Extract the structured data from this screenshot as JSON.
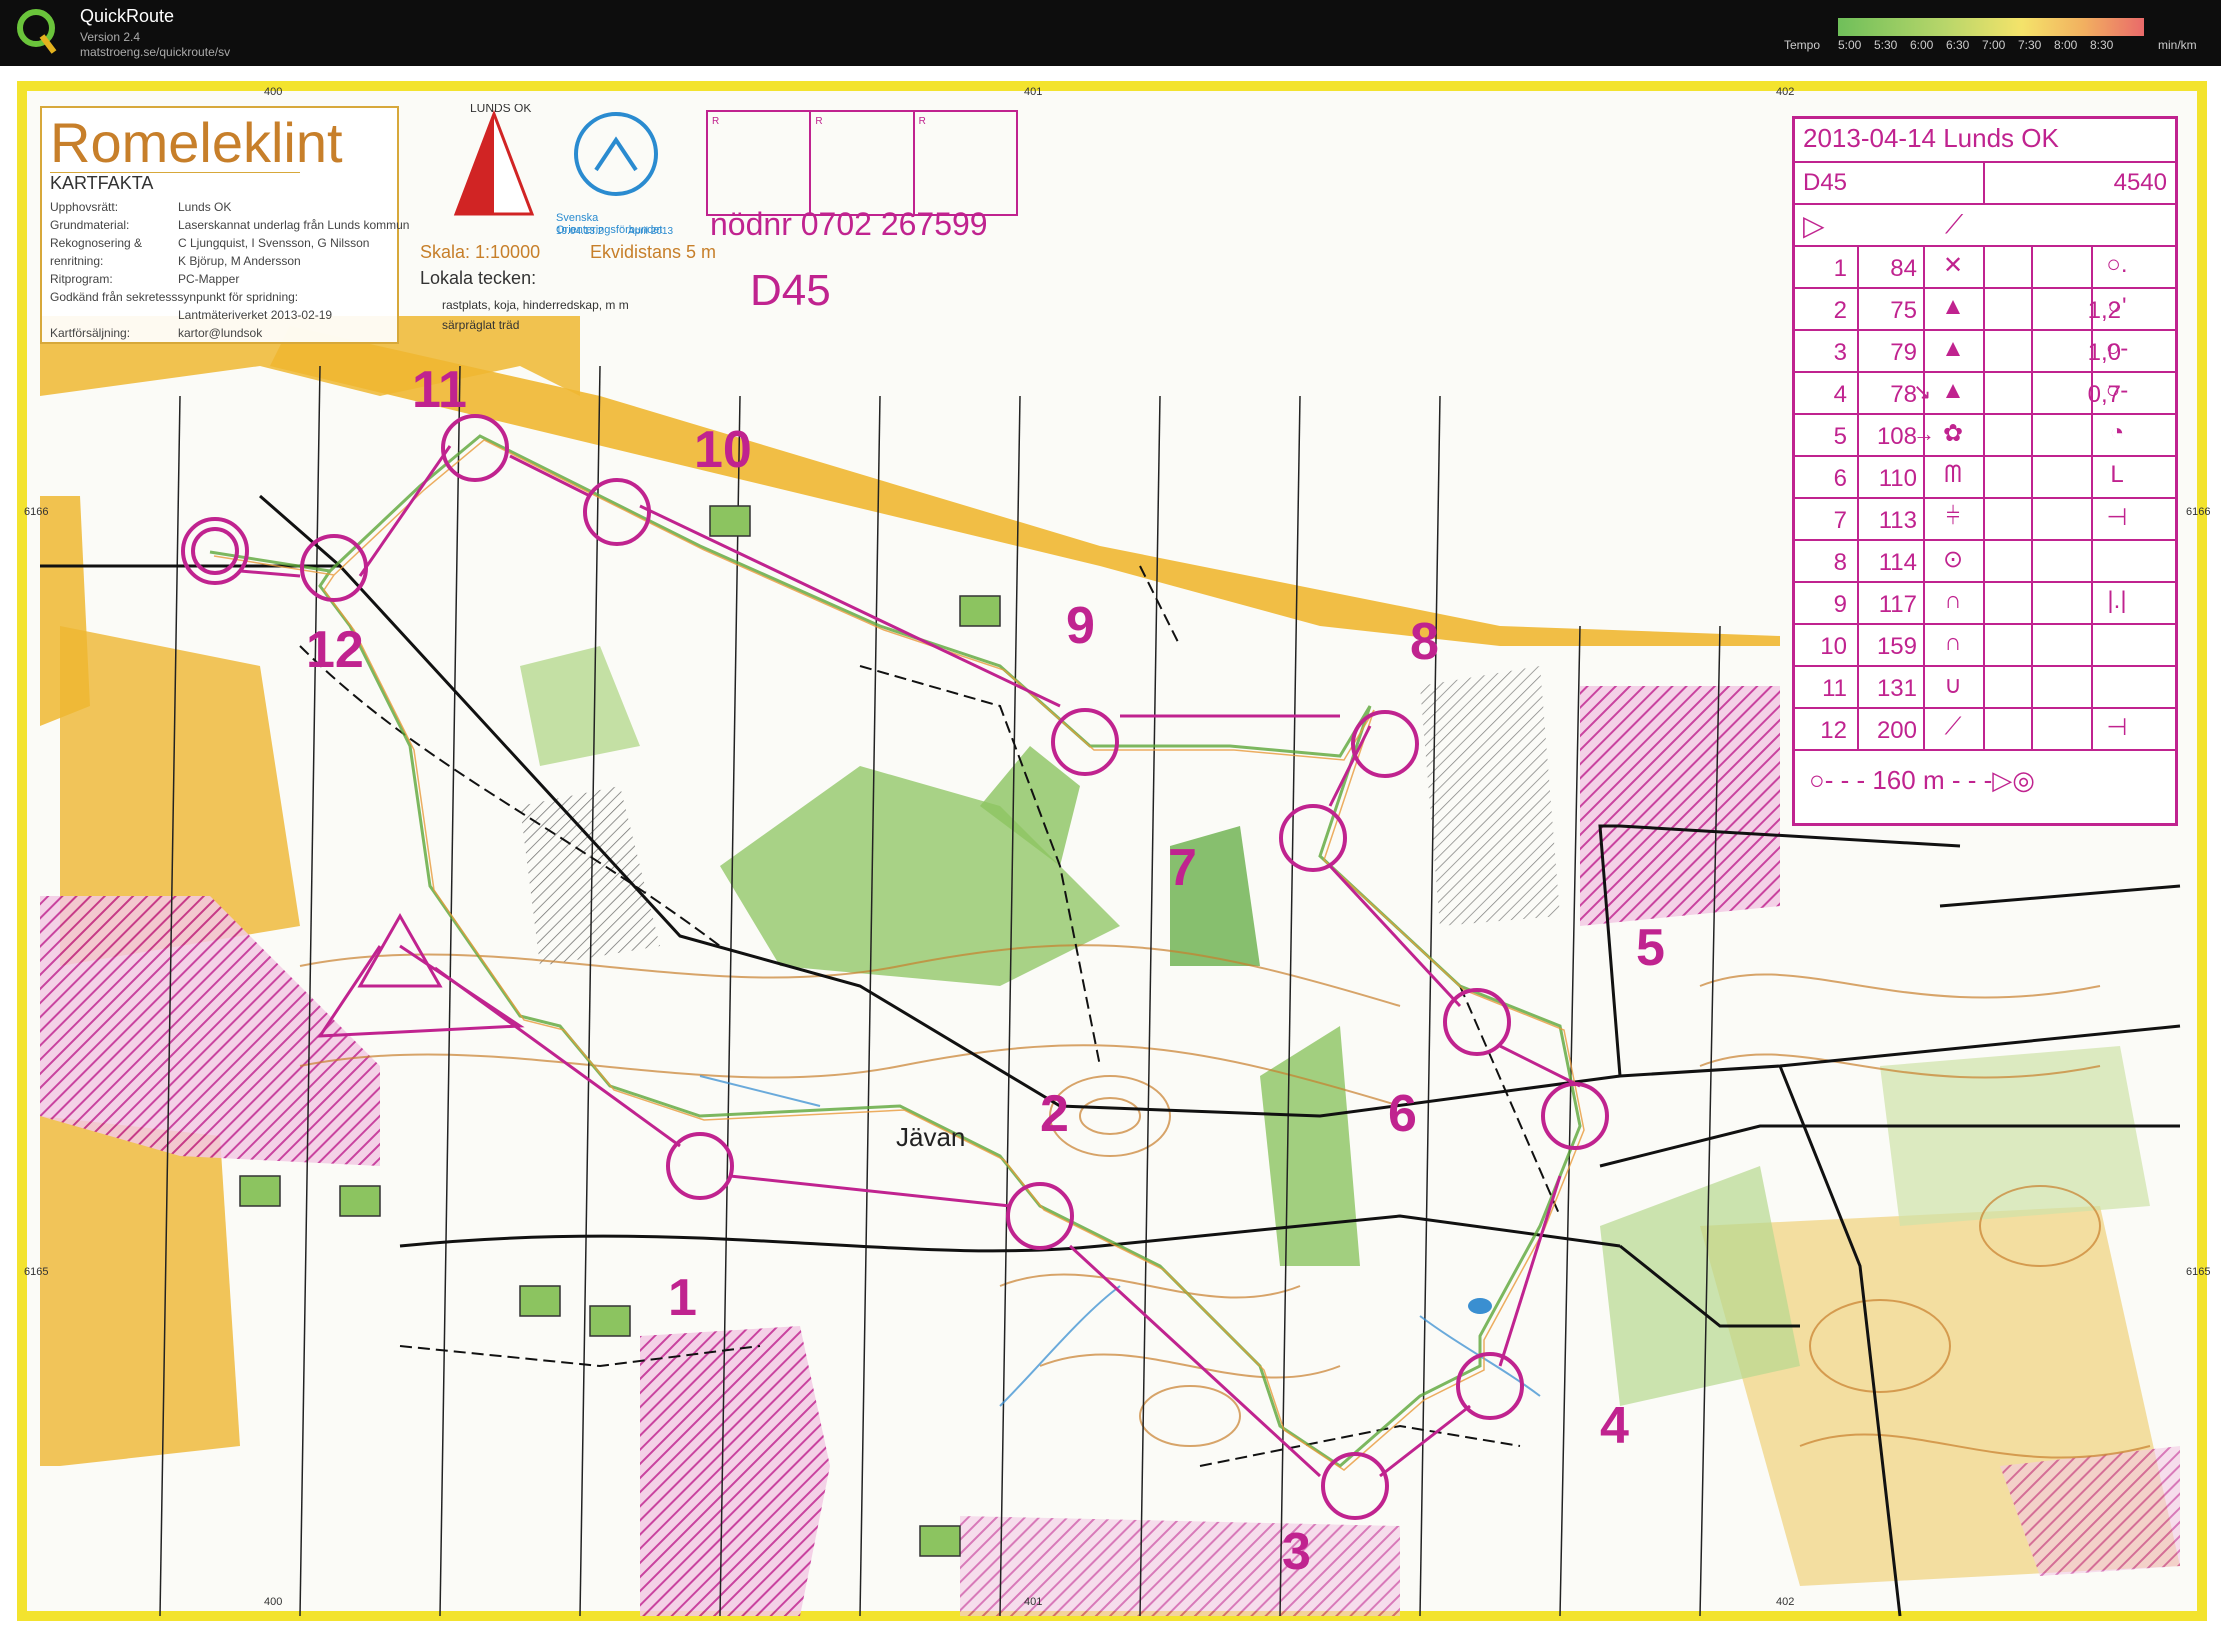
{
  "app": {
    "name": "QuickRoute",
    "version": "Version 2.4",
    "url": "matstroeng.se/quickroute/sv",
    "tempo_label": "Tempo",
    "tempo_unit": "min/km",
    "tempo_ticks": [
      "5:00",
      "5:30",
      "6:00",
      "6:30",
      "7:00",
      "7:30",
      "8:00",
      "8:30"
    ]
  },
  "map": {
    "title": "Romeleklint",
    "subtitle": "KARTFAKTA",
    "facts": [
      {
        "label": "Upphovsrätt:",
        "value": "Lunds OK"
      },
      {
        "label": "Grundmaterial:",
        "value": "Laserskannat underlag från Lunds kommun"
      },
      {
        "label": "Rekognosering &",
        "value": "C Ljungquist, I Svensson, G Nilsson"
      },
      {
        "label": "renritning:",
        "value": "K Björup, M Andersson"
      },
      {
        "label": "Ritprogram:",
        "value": "PC-Mapper"
      },
      {
        "label": "Godkänd från sekretesssynpunkt för spridning:",
        "value": ""
      },
      {
        "label": "",
        "value": "Lantmäteriverket 2013-02-19"
      },
      {
        "label": "Kartförsäljning:",
        "value": "kartor@lundsok"
      }
    ],
    "scale": "Skala: 1:10000",
    "contour": "Ekvidistans 5 m",
    "local_title": "Lokala tecken:",
    "local_1": "rastplats, koja, hinderredskap, m m",
    "local_2": "särpräglat träd",
    "club_logo": "LUNDS OK",
    "federation": "Svenska Orienteringsförbundet",
    "fed_date": "19.04.13.2",
    "fed_month": "April 2013",
    "box_labels": [
      "R",
      "R",
      "R"
    ],
    "phone": "nödnr 0702 267599",
    "course": "D45",
    "place_name": "Jävan",
    "grid": {
      "x": [
        "400",
        "401",
        "402"
      ],
      "y": [
        "6166",
        "6165"
      ]
    }
  },
  "description": {
    "date_club": "2013-04-14    Lunds OK",
    "class": "D45",
    "length": "4540",
    "controls": [
      {
        "n": "1",
        "code": "84",
        "feature": "✕",
        "dim": "",
        "loc": "○."
      },
      {
        "n": "2",
        "code": "75",
        "feature": "▲",
        "dim": "1,2",
        "loc": "○'"
      },
      {
        "n": "3",
        "code": "79",
        "feature": "▲",
        "dim": "1,0",
        "loc": "○-"
      },
      {
        "n": "4",
        "code": "78",
        "dir": "↘",
        "feature": "▲",
        "dim": "0,7",
        "loc": "○-"
      },
      {
        "n": "5",
        "code": "108",
        "dir": "→",
        "feature": "✿",
        "dim": "",
        "loc": "◔"
      },
      {
        "n": "6",
        "code": "110",
        "feature": "ᗰ",
        "dim": "",
        "loc": "L"
      },
      {
        "n": "7",
        "code": "113",
        "feature": "⫩",
        "dim": "",
        "loc": "⊣"
      },
      {
        "n": "8",
        "code": "114",
        "feature": "⊙",
        "dim": "",
        "loc": ""
      },
      {
        "n": "9",
        "code": "117",
        "feature": "∩",
        "dim": "",
        "loc": "|.|"
      },
      {
        "n": "10",
        "code": "159",
        "feature": "∩",
        "dim": "",
        "loc": ""
      },
      {
        "n": "11",
        "code": "131",
        "feature": "∪",
        "dim": "",
        "loc": ""
      },
      {
        "n": "12",
        "code": "200",
        "feature": "⟋",
        "dim": "",
        "loc": "⊣"
      }
    ],
    "finish": "○- - - 160 m - - -▷◎"
  },
  "controls_on_map": [
    {
      "label": "1"
    },
    {
      "label": "2"
    },
    {
      "label": "3"
    },
    {
      "label": "4"
    },
    {
      "label": "5"
    },
    {
      "label": "6"
    },
    {
      "label": "7"
    },
    {
      "label": "8"
    },
    {
      "label": "9"
    },
    {
      "label": "10"
    },
    {
      "label": "11"
    },
    {
      "label": "12"
    }
  ],
  "colors": {
    "course": "#c0238f",
    "yellow": "#efb731",
    "green": "#8cc460",
    "frame": "#f3e32e"
  }
}
